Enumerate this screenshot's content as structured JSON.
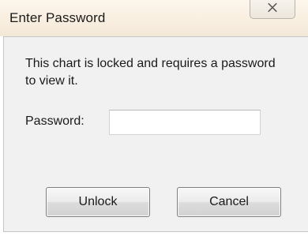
{
  "window": {
    "title": "Enter Password"
  },
  "dialog": {
    "message": "This chart is locked and requires a password to view it.",
    "password_label": "Password:",
    "password_value": "",
    "unlock_label": "Unlock",
    "cancel_label": "Cancel"
  },
  "icons": {
    "close": "close-icon"
  },
  "colors": {
    "titlebar": "#f8eedf",
    "dialog_background": "#f1f1f1"
  }
}
